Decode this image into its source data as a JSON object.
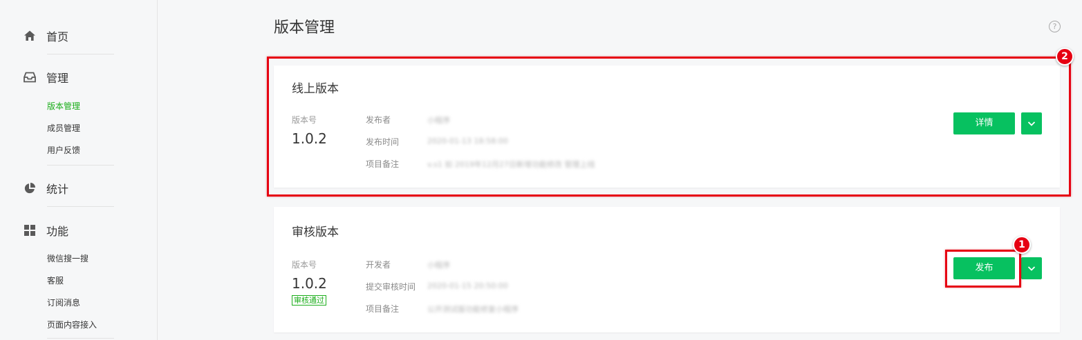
{
  "sidebar": {
    "home": {
      "label": "首页",
      "icon": "home-icon"
    },
    "manage": {
      "label": "管理",
      "icon": "inbox-icon",
      "items": [
        "版本管理",
        "成员管理",
        "用户反馈"
      ]
    },
    "stats": {
      "label": "统计",
      "icon": "pie-chart-icon"
    },
    "features": {
      "label": "功能",
      "icon": "grid-icon",
      "items": [
        "微信搜一搜",
        "客服",
        "订阅消息",
        "页面内容接入"
      ]
    }
  },
  "page": {
    "title": "版本管理",
    "help": "?"
  },
  "online": {
    "title": "线上版本",
    "version_label": "版本号",
    "version": "1.0.2",
    "meta": [
      {
        "label": "发布者",
        "value": "小程序"
      },
      {
        "label": "发布时间",
        "value": "2020-01-13 18:58:00"
      },
      {
        "label": "项目备注",
        "value": "v.s1 如 2019年12月27日新增功能修改 管理上线"
      }
    ],
    "primary_button": "详情"
  },
  "review": {
    "title": "审核版本",
    "version_label": "版本号",
    "version": "1.0.2",
    "status": "审核通过",
    "meta": [
      {
        "label": "开发者",
        "value": "小程序"
      },
      {
        "label": "提交审核时间",
        "value": "2020-01-15 20:50:00"
      },
      {
        "label": "项目备注",
        "value": "公开测试版功能修复小程序"
      }
    ],
    "primary_button": "发布"
  },
  "annotations": [
    "1",
    "2"
  ],
  "colors": {
    "accent": "#07c160",
    "active_nav": "#1aad19",
    "annotation": "#e60012"
  }
}
